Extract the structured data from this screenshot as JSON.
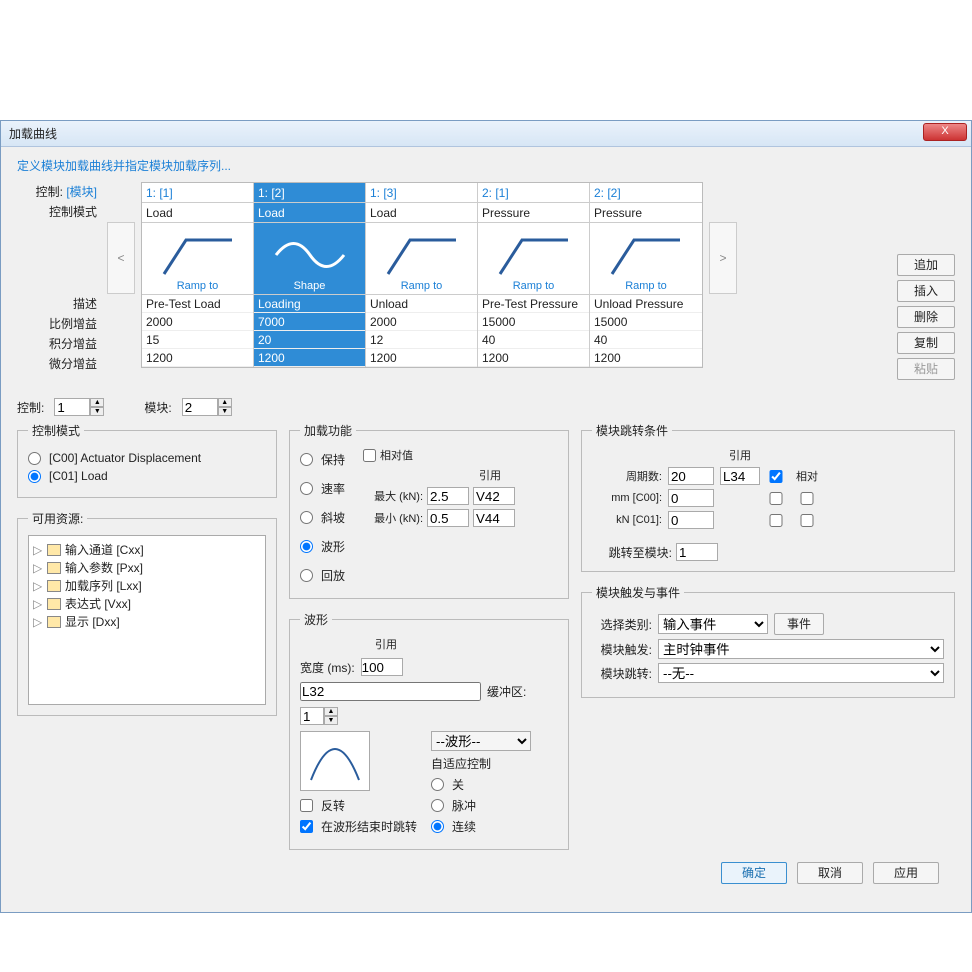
{
  "titlebar": {
    "title": "加载曲线",
    "close": "X"
  },
  "link_text": "定义模块加载曲线并指定模块加载序列...",
  "labels": {
    "control": "控制:",
    "module_tag": "[模块]",
    "control_mode": "控制模式",
    "desc": "描述",
    "p_gain": "比例增益",
    "i_gain": "积分增益",
    "d_gain": "微分增益",
    "prev": "<",
    "next": ">"
  },
  "columns": [
    {
      "hdr": "1: [1]",
      "mode": "Load",
      "shape": "ramp",
      "shape_lbl": "Ramp to",
      "desc": "Pre-Test Load",
      "p": "2000",
      "i": "15",
      "d": "1200"
    },
    {
      "hdr": "1: [2]",
      "mode": "Load",
      "shape": "sine",
      "shape_lbl": "Shape",
      "desc": "Loading",
      "p": "7000",
      "i": "20",
      "d": "1200",
      "selected": true
    },
    {
      "hdr": "1: [3]",
      "mode": "Load",
      "shape": "ramp",
      "shape_lbl": "Ramp to",
      "desc": "Unload",
      "p": "2000",
      "i": "12",
      "d": "1200"
    },
    {
      "hdr": "2: [1]",
      "mode": "Pressure",
      "shape": "ramp",
      "shape_lbl": "Ramp to",
      "desc": "Pre-Test Pressure",
      "p": "15000",
      "i": "40",
      "d": "1200"
    },
    {
      "hdr": "2: [2]",
      "mode": "Pressure",
      "shape": "ramp",
      "shape_lbl": "Ramp to",
      "desc": "Unload Pressure",
      "p": "15000",
      "i": "40",
      "d": "1200"
    }
  ],
  "side_buttons": {
    "add": "追加",
    "insert": "插入",
    "delete": "删除",
    "copy": "复制",
    "paste": "粘贴"
  },
  "mid": {
    "control_lbl": "控制:",
    "control_val": "1",
    "module_lbl": "模块:",
    "module_val": "2"
  },
  "control_mode_group": {
    "legend": "控制模式",
    "opt1": "[C00] Actuator Displacement",
    "opt2": "[C01] Load"
  },
  "resources": {
    "legend": "可用资源:",
    "items": [
      "输入通道 [Cxx]",
      "输入参数 [Pxx]",
      "加载序列 [Lxx]",
      "表达式 [Vxx]",
      "显示 [Dxx]"
    ]
  },
  "load_fn": {
    "legend": "加载功能",
    "opts": [
      "保持",
      "速率",
      "斜坡",
      "波形",
      "回放"
    ],
    "relative": "相对值",
    "ref_hdr": "引用",
    "max_lbl": "最大 (kN):",
    "max_val": "2.5",
    "max_ref": "V42",
    "min_lbl": "最小 (kN):",
    "min_val": "0.5",
    "min_ref": "V44"
  },
  "wave": {
    "legend": "波形",
    "width_lbl": "宽度 (ms):",
    "width_val": "100",
    "width_ref": "L32",
    "ref_hdr": "引用",
    "buffer_lbl": "缓冲区:",
    "buffer_val": "1",
    "select_placeholder": "--波形--",
    "auto_ctrl": "自适应控制",
    "auto_opts": [
      "关",
      "脉冲",
      "连续"
    ],
    "invert": "反转",
    "jump_on_end": "在波形结束时跳转"
  },
  "jump_cond": {
    "legend": "模块跳转条件",
    "ref_hdr": "引用",
    "period_lbl": "周期数:",
    "period_val": "20",
    "period_ref": "L34",
    "relative_hdr": "相对",
    "mm_lbl": "mm [C00]:",
    "mm_val": "0",
    "kn_lbl": "kN [C01]:",
    "kn_val": "0",
    "jump_to_lbl": "跳转至模块:",
    "jump_to_val": "1"
  },
  "trigger": {
    "legend": "模块触发与事件",
    "type_lbl": "选择类别:",
    "type_val": "输入事件",
    "event_btn": "事件",
    "trig_lbl": "模块触发:",
    "trig_val": "主时钟事件",
    "jump_lbl": "模块跳转:",
    "jump_val": "--无--"
  },
  "footer": {
    "ok": "确定",
    "cancel": "取消",
    "apply": "应用"
  }
}
